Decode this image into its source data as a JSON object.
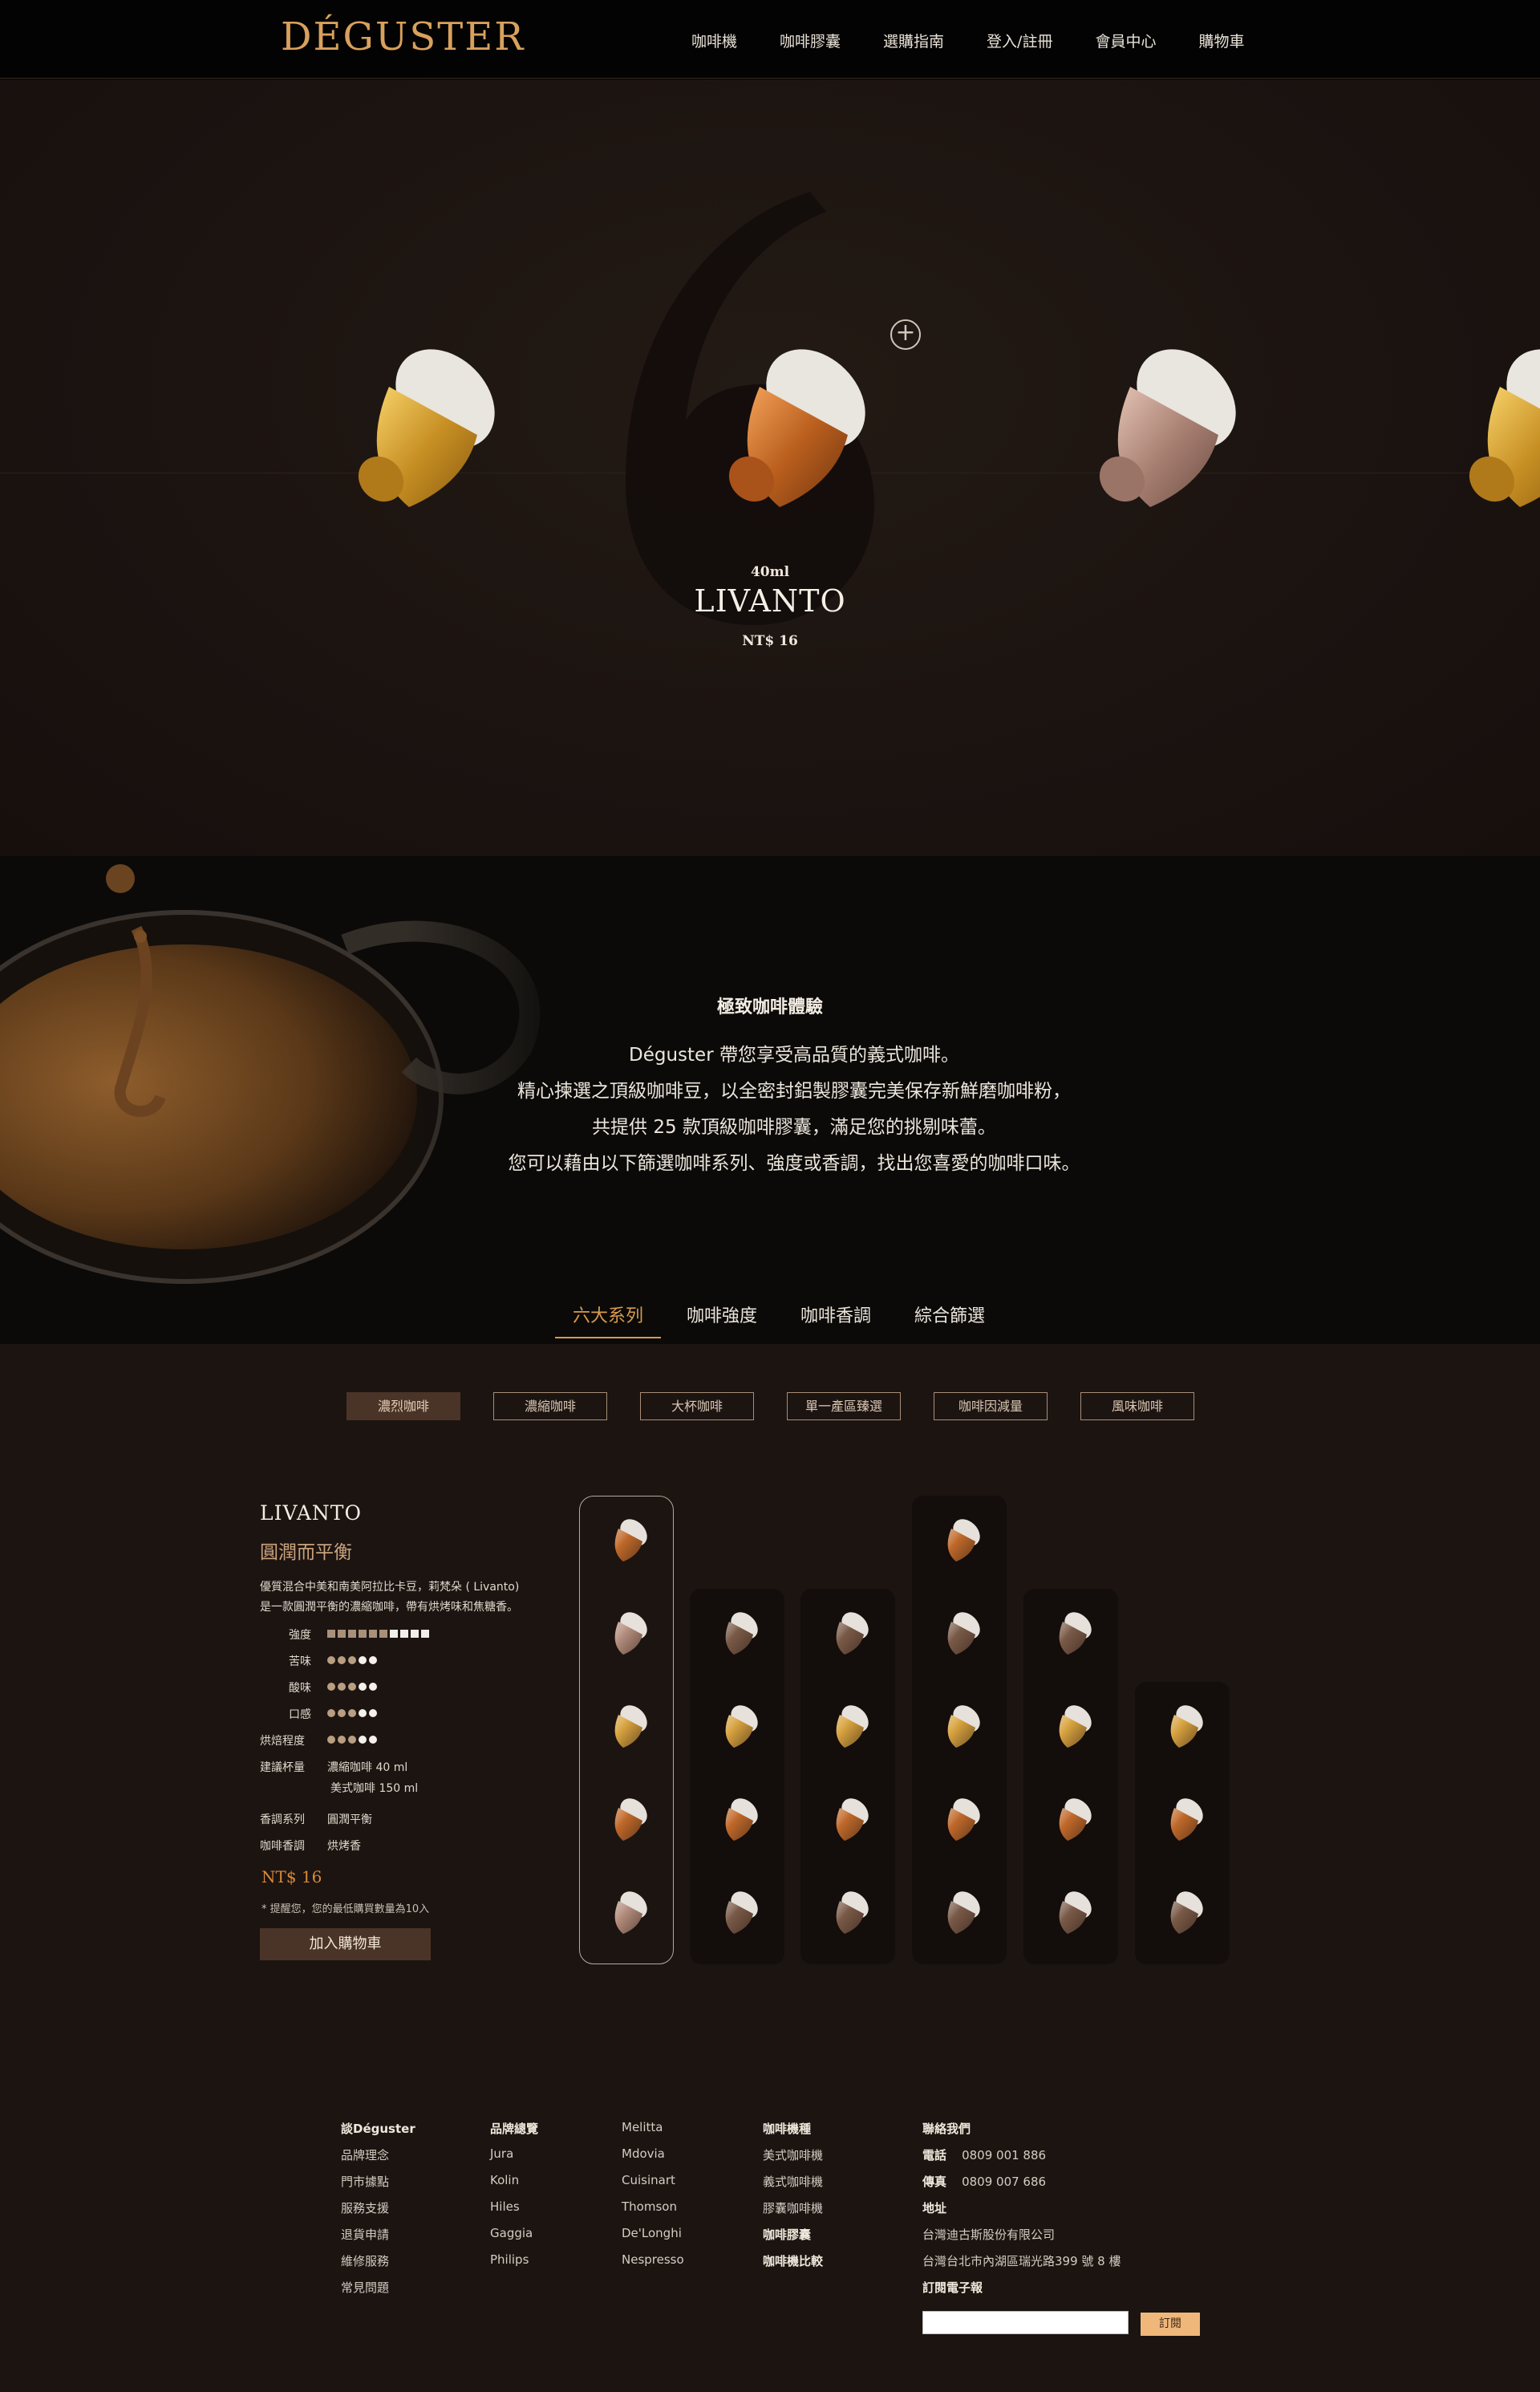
{
  "nav": {
    "logo": "DÉGUSTER",
    "items": [
      "咖啡機",
      "咖啡膠囊",
      "選購指南",
      "登入/註冊",
      "會員中心",
      "購物車"
    ]
  },
  "hero": {
    "volume": "40ml",
    "name": "LIVANTO",
    "price": "NT$ 16"
  },
  "intro": {
    "title": "極致咖啡體驗",
    "lines": [
      "Déguster 帶您享受高品質的義式咖啡。",
      "精心揀選之頂級咖啡豆，以全密封鋁製膠囊完美保存新鮮磨咖啡粉，",
      "共提供 25 款頂級咖啡膠囊，滿足您的挑剔味蕾。",
      "您可以藉由以下篩選咖啡系列、強度或香調，找出您喜愛的咖啡口味。"
    ],
    "tabs": [
      "六大系列",
      "咖啡強度",
      "咖啡香調",
      "綜合篩選"
    ]
  },
  "filters": [
    "濃烈咖啡",
    "濃縮咖啡",
    "大杯咖啡",
    "單一產區臻選",
    "咖啡因減量",
    "風味咖啡"
  ],
  "detail": {
    "name": "LIVANTO",
    "subtitle": "圓潤而平衡",
    "desc": [
      "優質混合中美和南美阿拉比卡豆，莉梵朵 ( Livanto)",
      "是一款圓潤平衡的濃縮咖啡，帶有烘烤味和焦糖香。"
    ],
    "intensity_label": "強度",
    "intensity": 6,
    "intensity_max": 10,
    "ratings": [
      {
        "label": "苦味",
        "value": 3,
        "max": 5
      },
      {
        "label": "酸味",
        "value": 3,
        "max": 5
      },
      {
        "label": "口感",
        "value": 3,
        "max": 5
      },
      {
        "label": "烘焙程度",
        "value": 3,
        "max": 5
      }
    ],
    "cup_label": "建議杯量",
    "cup_lines": [
      "濃縮咖啡 40 ml",
      "美式咖啡 150 ml"
    ],
    "series_label": "香調系列",
    "series_value": "圓潤平衡",
    "aroma_label": "咖啡香調",
    "aroma_value": "烘烤香",
    "price": "NT$ 16",
    "note": "* 提醒您，您的最低購買數量為10入",
    "cart_button": "加入購物車"
  },
  "colors": {
    "accent": "#d99a4e",
    "gold_pod": "#d7a23f",
    "copper_pod": "#c0692a",
    "rose_pod": "#b48e7e",
    "cocoa_pod": "#7a5a48"
  },
  "footer": {
    "cols": [
      {
        "title": "談Déguster",
        "items": [
          "品牌理念",
          "門市據點",
          "服務支援",
          "退貨申請",
          "維修服務",
          "常見問題"
        ]
      },
      {
        "title": "品牌總覽",
        "items": [
          "Jura",
          "Kolin",
          "Hiles",
          "Gaggia",
          "Philips"
        ]
      },
      {
        "title": "",
        "items": [
          "Melitta",
          "Mdovia",
          "Cuisinart",
          "Thomson",
          "De'Longhi",
          "Nespresso"
        ]
      },
      {
        "title": "咖啡機種",
        "items": [
          "美式咖啡機",
          "義式咖啡機",
          "膠囊咖啡機",
          "咖啡膠囊",
          "咖啡機比較"
        ]
      }
    ],
    "contact": {
      "title": "聯絡我們",
      "phone_label": "電話",
      "phone": "0809 001 886",
      "fax_label": "傳真",
      "fax": "0809 007 686",
      "address_label": "地址",
      "company": "台灣迪古斯股份有限公司",
      "address": "台灣台北市內湖區瑞光路399 號 8 樓",
      "newsletter": "訂閱電子報",
      "subscribe": "訂閱"
    }
  }
}
